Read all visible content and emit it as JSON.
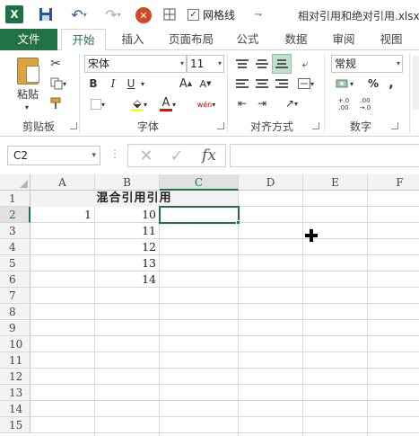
{
  "titlebar": {
    "app_logo": "X",
    "gridlines_checkbox_label": "网格线",
    "gridlines_checked": true,
    "window_title": "相对引用和绝对引用.xlsx",
    "icons": [
      "excel-logo-icon",
      "save-icon",
      "undo-icon",
      "redo-icon",
      "close-workbook-icon",
      "border-icon",
      "checkbox-icon",
      "customize-toolbar-icon"
    ]
  },
  "tabs": {
    "file": "文件",
    "home": "开始",
    "insert": "插入",
    "page_layout": "页面布局",
    "formulas": "公式",
    "data": "数据",
    "review": "审阅",
    "view": "视图",
    "active": "开始"
  },
  "ribbon": {
    "clipboard": {
      "label": "剪贴板",
      "paste_label": "粘贴"
    },
    "font": {
      "label": "字体",
      "font_name": "宋体",
      "font_size": "11",
      "bold": "B",
      "italic": "I",
      "underline": "U",
      "grow": "A",
      "shrink": "A",
      "font_color": "A",
      "phonetic": "wén"
    },
    "alignment": {
      "label": "对齐方式"
    },
    "number": {
      "label": "数字",
      "format": "常规",
      "percent": "%",
      "comma": ",",
      "increase_decimal": "+.0 .00",
      "decrease_decimal": ".00 →.0"
    },
    "colors": {
      "fill_highlight": "#ffff00",
      "font_color": "#ff0000",
      "accent": "#217346"
    }
  },
  "formula_bar": {
    "name_box": "C2",
    "cancel": "✕",
    "enter": "✓",
    "fx": "fx",
    "content": ""
  },
  "sheet": {
    "columns": [
      "A",
      "B",
      "C",
      "D",
      "E",
      "F"
    ],
    "rows": [
      "1",
      "2",
      "3",
      "4",
      "5",
      "6",
      "7",
      "8",
      "9",
      "10",
      "11",
      "12",
      "13",
      "14",
      "15"
    ],
    "selected_cell": "C2",
    "merged_header": "混合引用引用",
    "a2": "1",
    "b_values": [
      "10",
      "11",
      "12",
      "13",
      "14"
    ]
  }
}
